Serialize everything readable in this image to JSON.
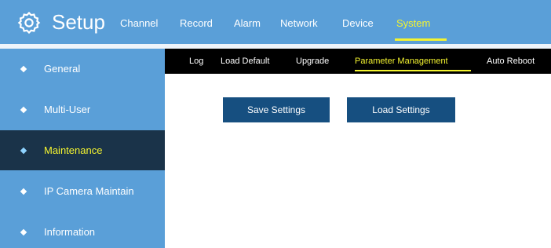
{
  "header": {
    "title": "Setup",
    "logo_icon": "gear-icon",
    "nav": [
      {
        "label": "Channel",
        "active": false
      },
      {
        "label": "Record",
        "active": false
      },
      {
        "label": "Alarm",
        "active": false
      },
      {
        "label": "Network",
        "active": false
      },
      {
        "label": "Device",
        "active": false
      },
      {
        "label": "System",
        "active": true
      }
    ]
  },
  "sidebar": {
    "items": [
      {
        "label": "General",
        "active": false
      },
      {
        "label": "Multi-User",
        "active": false
      },
      {
        "label": "Maintenance",
        "active": true
      },
      {
        "label": "IP Camera Maintain",
        "active": false
      },
      {
        "label": "Information",
        "active": false
      }
    ]
  },
  "subtabs": [
    {
      "label": "Log",
      "active": false
    },
    {
      "label": "Load Default",
      "active": false
    },
    {
      "label": "Upgrade",
      "active": false
    },
    {
      "label": "Parameter Management",
      "active": true
    },
    {
      "label": "Auto Reboot",
      "active": false
    }
  ],
  "main": {
    "save_label": "Save Settings",
    "load_label": "Load Settings"
  },
  "colors": {
    "header_bg": "#5a9fd8",
    "sidebar_bg": "#5a9fd8",
    "active_item_bg": "#1a3349",
    "active_text": "#f4f430",
    "button_bg": "#164f80",
    "subtab_bg": "#000000"
  }
}
